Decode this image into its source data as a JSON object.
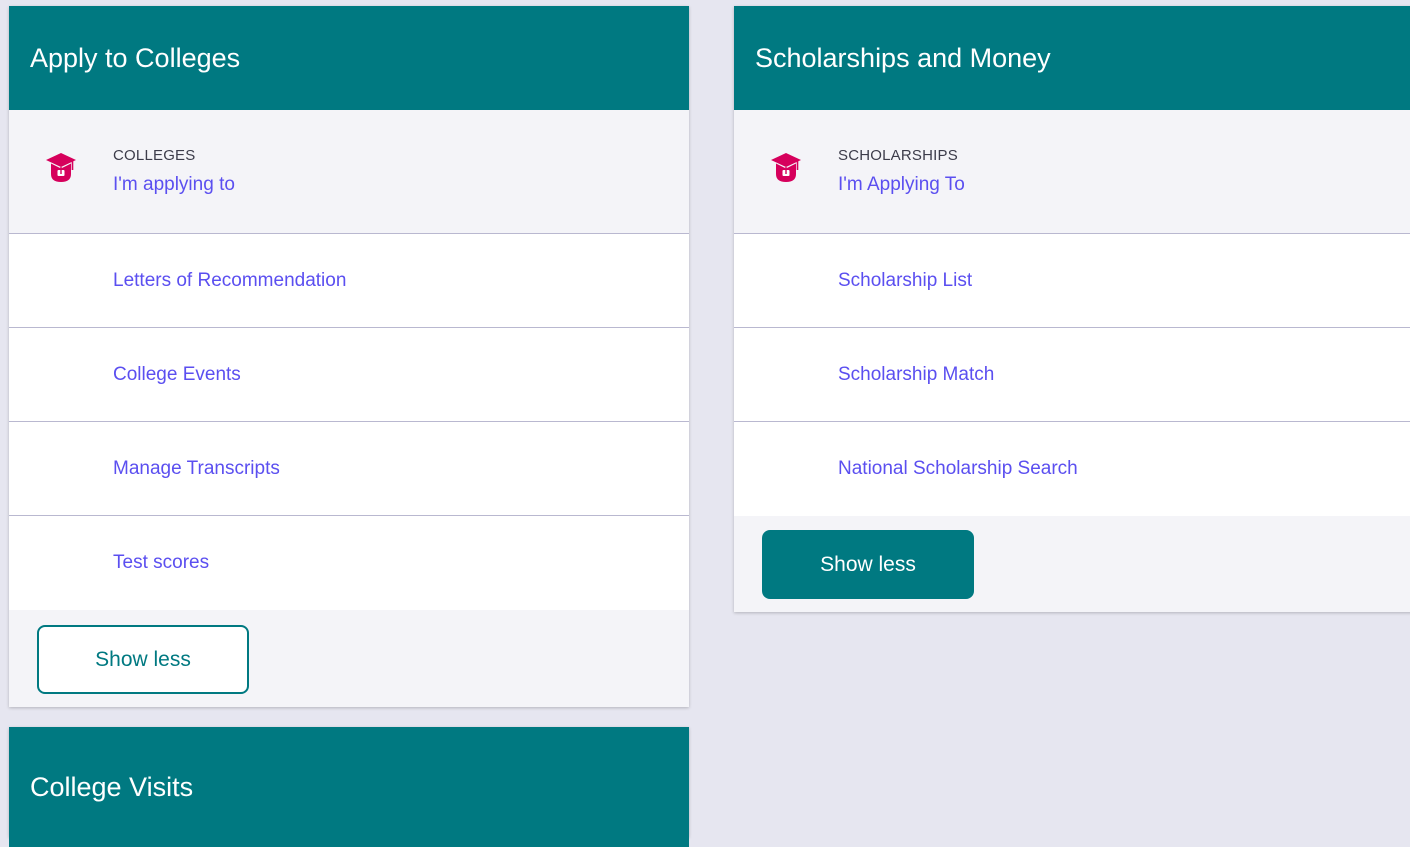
{
  "colors": {
    "header": "#007981",
    "accent_link": "#5b4ff0",
    "icon": "#d6005c",
    "background": "#e6e6f0"
  },
  "apply_card": {
    "title": "Apply to Colleges",
    "featured": {
      "icon": "graduation-cap-icon",
      "eyebrow": "COLLEGES",
      "link": "I'm applying to"
    },
    "links": [
      "Letters of Recommendation",
      "College Events",
      "Manage Transcripts",
      "Test scores"
    ],
    "button": "Show less"
  },
  "scholarship_card": {
    "title": "Scholarships and Money",
    "featured": {
      "icon": "graduation-cap-icon",
      "eyebrow": "SCHOLARSHIPS",
      "link": "I'm Applying To"
    },
    "links": [
      "Scholarship List",
      "Scholarship Match",
      "National Scholarship Search"
    ],
    "button": "Show less"
  },
  "visits_card": {
    "title": "College Visits"
  }
}
